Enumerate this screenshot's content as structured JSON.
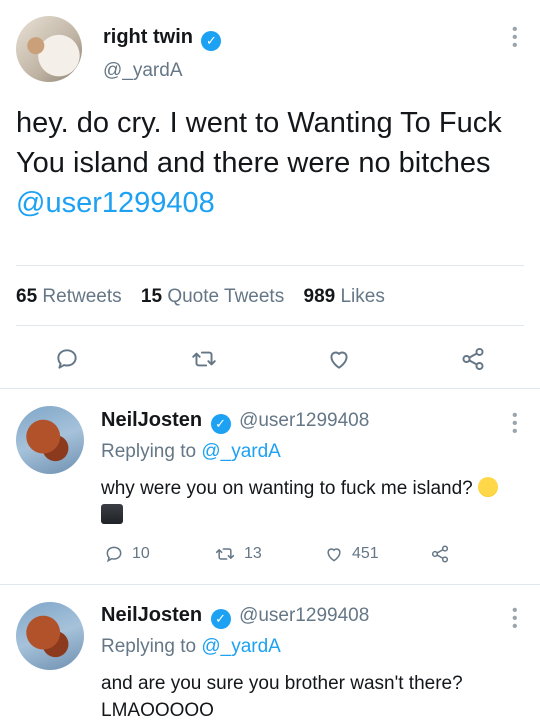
{
  "tweet": {
    "display_name": "right twin",
    "handle": "@_yardA",
    "text_plain": "hey. do cry. I went to Wanting To Fuck You island and there were no bitches ",
    "text_mention": "@user1299408",
    "stats": {
      "retweets_count": "65",
      "retweets_label": "Retweets",
      "quote_count": "15",
      "quote_label": "Quote Tweets",
      "likes_count": "989",
      "likes_label": "Likes"
    },
    "actions": [
      "reply-icon",
      "retweet-icon",
      "like-icon",
      "share-icon"
    ]
  },
  "replies": [
    {
      "display_name": "NeilJosten",
      "handle": "@user1299408",
      "replying_prefix": "Replying to ",
      "replying_handle": "@_yardA",
      "text": "why were you on wanting to fuck me island?",
      "emojis": [
        "raised-eyebrow-emoji",
        "camera-flash-emoji"
      ],
      "reply_count": "10",
      "retweet_count": "13",
      "like_count": "451"
    },
    {
      "display_name": "NeilJosten",
      "handle": "@user1299408",
      "replying_prefix": "Replying to ",
      "replying_handle": "@_yardA",
      "text": "and are you sure you brother wasn't there? LMAOOOOO"
    }
  ],
  "colors": {
    "accent": "#1da1f2",
    "text": "#14171a",
    "muted": "#657786",
    "divider": "#e1e8ed"
  }
}
